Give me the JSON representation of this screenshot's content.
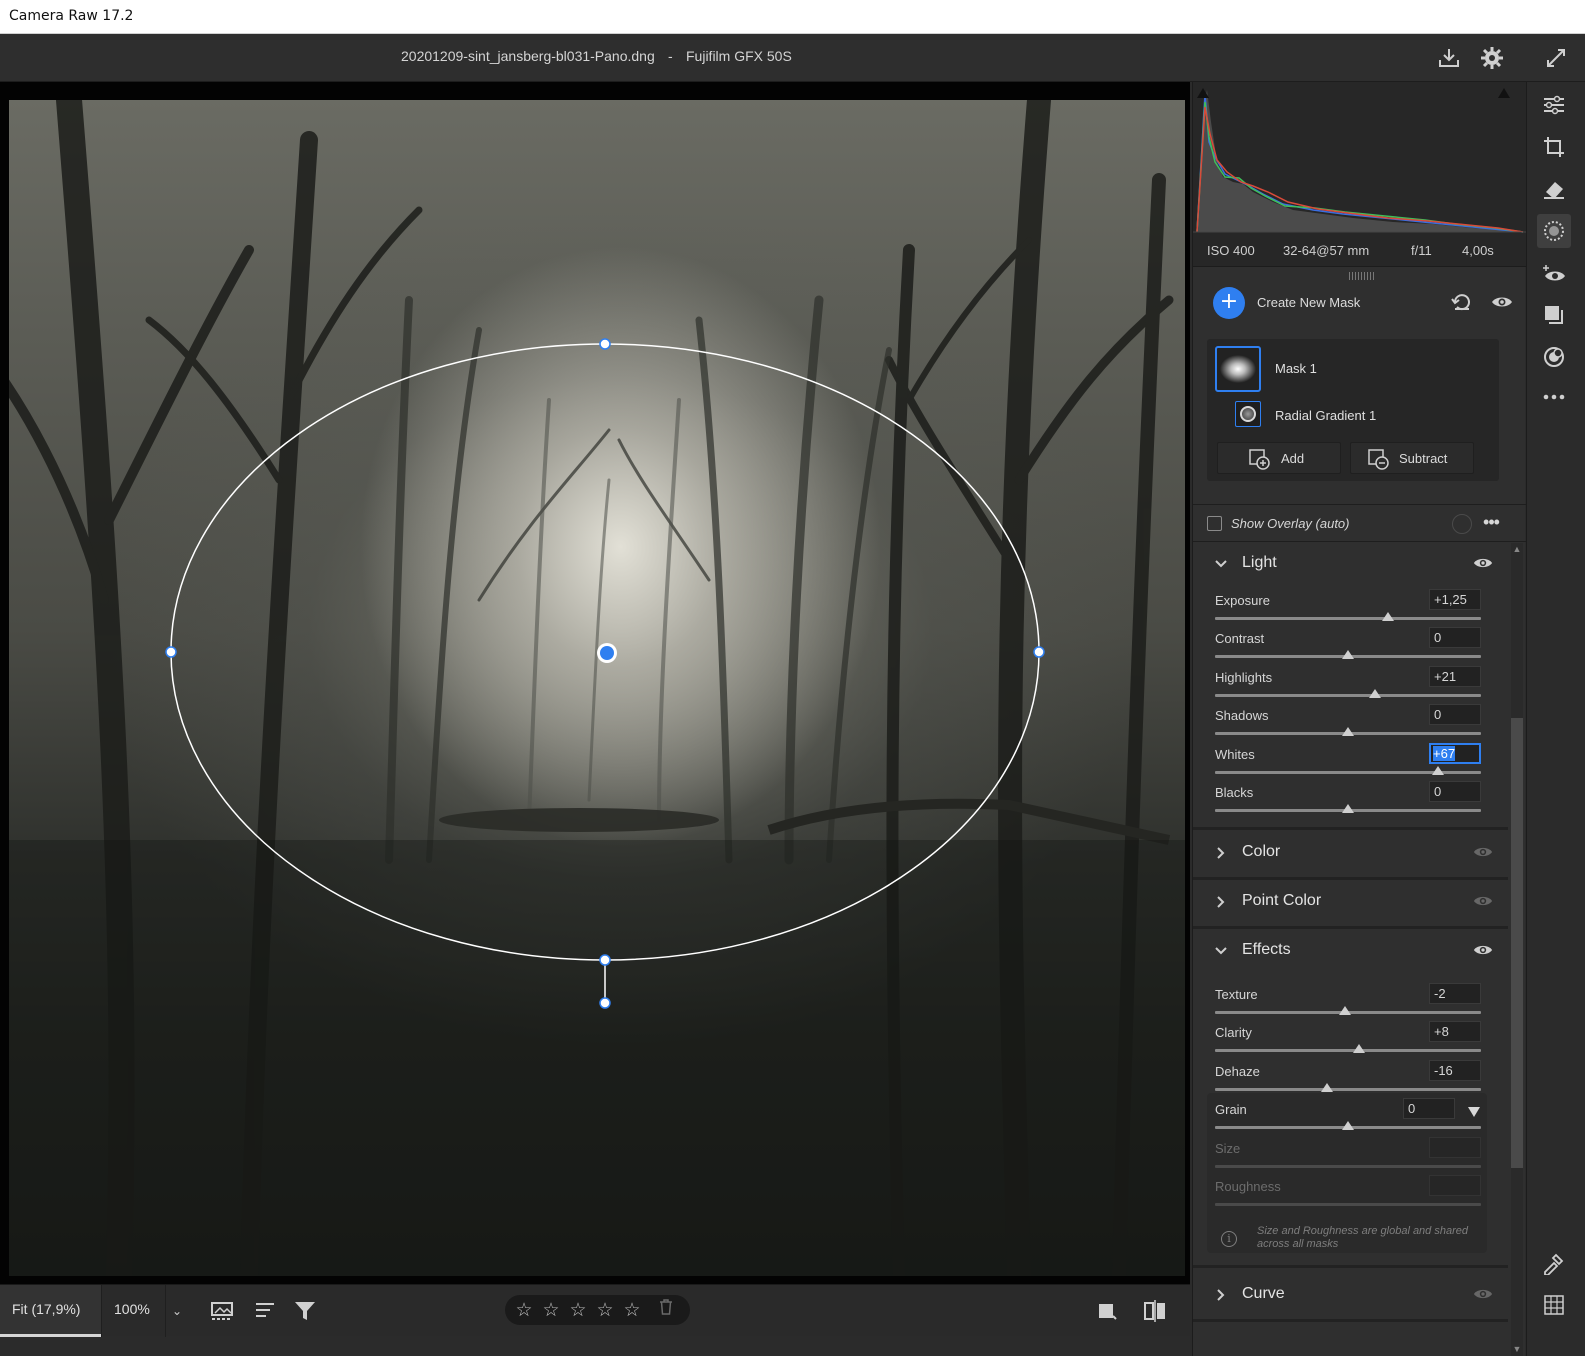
{
  "window": {
    "title": "Camera Raw 17.2"
  },
  "header": {
    "filename": "20201209-sint_jansberg-bl031-Pano.dng",
    "separator": "-",
    "camera": "Fujifilm GFX 50S",
    "icons": [
      "save-icon",
      "gear-icon",
      "fullscreen-icon"
    ]
  },
  "camera_info": {
    "iso": "ISO 400",
    "lens": "32-64@57 mm",
    "aperture": "f/11",
    "shutter": "4,00s"
  },
  "masks": {
    "create_label": "Create New Mask",
    "mask_name": "Mask 1",
    "component_name": "Radial Gradient 1",
    "add_label": "Add",
    "subtract_label": "Subtract",
    "show_overlay_label": "Show Overlay (auto)"
  },
  "sections": {
    "light": {
      "title": "Light",
      "expanded": true,
      "sliders": [
        {
          "label": "Exposure",
          "value": "+1,25",
          "position": 0.65
        },
        {
          "label": "Contrast",
          "value": "0",
          "position": 0.5
        },
        {
          "label": "Highlights",
          "value": "+21",
          "position": 0.6
        },
        {
          "label": "Shadows",
          "value": "0",
          "position": 0.5
        },
        {
          "label": "Whites",
          "value": "+67",
          "position": 0.84,
          "active": true
        },
        {
          "label": "Blacks",
          "value": "0",
          "position": 0.5
        }
      ]
    },
    "color": {
      "title": "Color",
      "expanded": false
    },
    "point_color": {
      "title": "Point Color",
      "expanded": false
    },
    "effects": {
      "title": "Effects",
      "expanded": true,
      "sliders": [
        {
          "label": "Texture",
          "value": "-2",
          "position": 0.49
        },
        {
          "label": "Clarity",
          "value": "+8",
          "position": 0.54
        },
        {
          "label": "Dehaze",
          "value": "-16",
          "position": 0.42
        },
        {
          "label": "Grain",
          "value": "0",
          "position": 0.5
        },
        {
          "label": "Size",
          "value": "",
          "position": null,
          "disabled": true
        },
        {
          "label": "Roughness",
          "value": "",
          "position": null,
          "disabled": true
        }
      ],
      "grain_note": "Size and Roughness are global and shared across all masks"
    },
    "curve": {
      "title": "Curve",
      "expanded": false
    }
  },
  "bottom_bar": {
    "zoom_fit": "Fit (17,9%)",
    "zoom_100": "100%",
    "rating_stars": 5,
    "rating_value": 0
  },
  "tools": [
    "edit-icon",
    "crop-icon",
    "heal-icon",
    "masking-icon",
    "redeye-icon",
    "snapshots-icon",
    "presets-icon",
    "more-icon",
    "sampler-icon",
    "grid-icon"
  ],
  "colors": {
    "accent": "#2f7ff0",
    "panel_bg": "#2f2f2f",
    "canvas_bg": "#030303"
  }
}
